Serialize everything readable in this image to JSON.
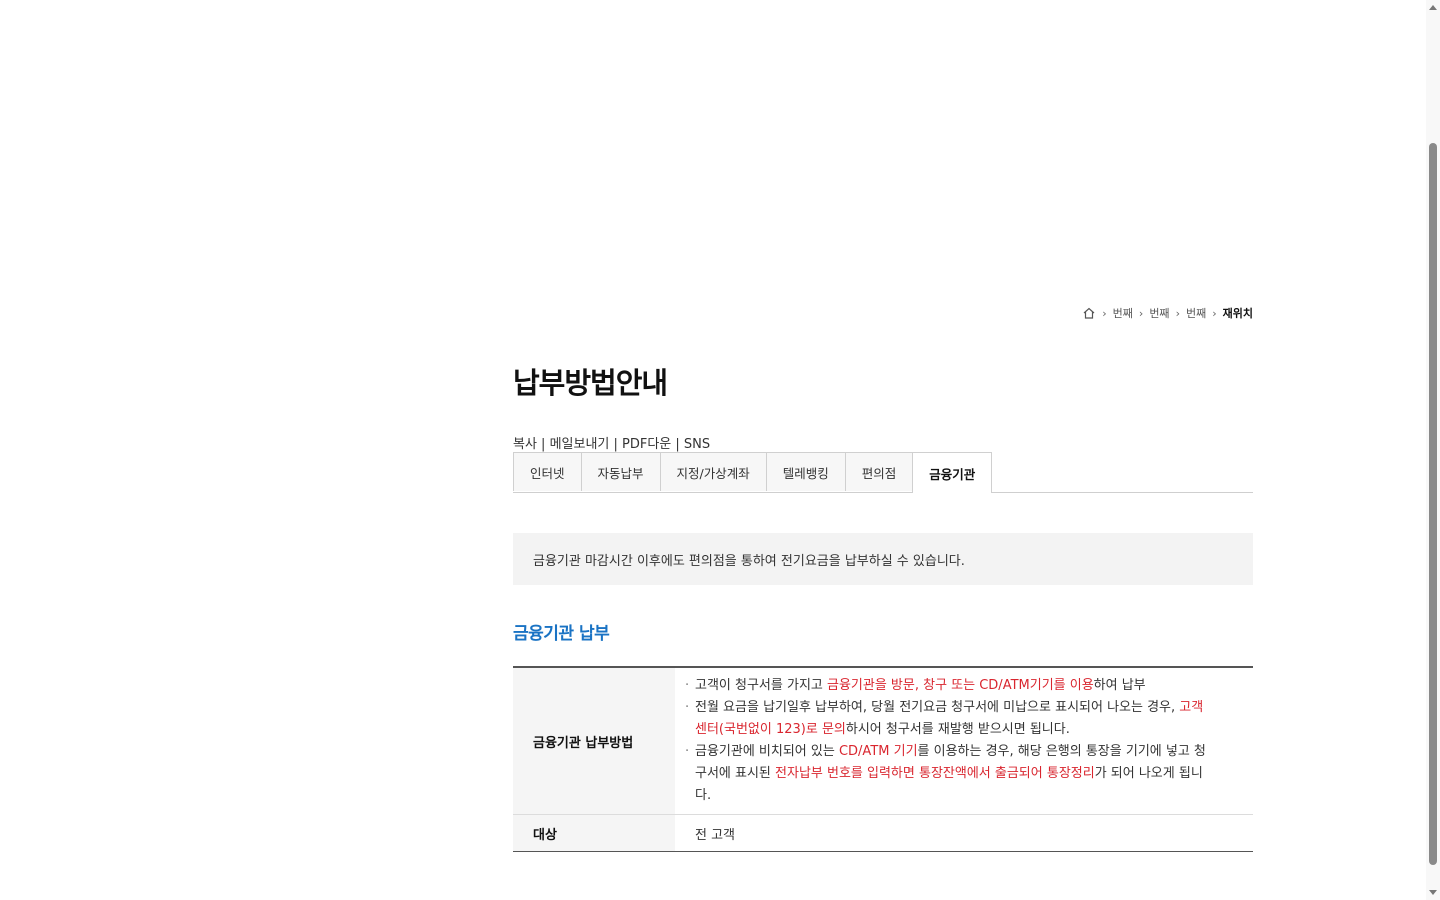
{
  "breadcrumb": {
    "items": [
      "번째",
      "번째",
      "번째"
    ],
    "current": "재위치"
  },
  "page": {
    "title": "납부방법안내",
    "tools": "복사 | 메일보내기 | PDF다운 | SNS"
  },
  "tabs": [
    {
      "label": "인터넷"
    },
    {
      "label": "자동납부"
    },
    {
      "label": "지정/가상계좌"
    },
    {
      "label": "텔레뱅킹"
    },
    {
      "label": "편의점"
    },
    {
      "label": "금융기관"
    }
  ],
  "notice": "금융기관 마감시간 이후에도 편의점을 통하여 전기요금을 납부하실 수 있습니다.",
  "section": {
    "title": "금융기관 납부"
  },
  "table": {
    "row1": {
      "header": "금융기관 납부방법",
      "b1": {
        "t1": "고객이 청구서를 가지고 ",
        "r1": "금융기관을 방문, 창구 또는 CD/ATM기기를 이용",
        "t2": "하여 납부"
      },
      "b2": {
        "t1": "전월 요금을 납기일후 납부하여, 당월 전기요금 청구서에 미납으로 표시되어 나오는 경우, ",
        "r1": "고객센터(국번없이 123)로 문의",
        "t2": "하시어 청구서를 재발행 받으시면 됩니다."
      },
      "b3": {
        "t1": "금융기관에 비치되어 있는 ",
        "r1": "CD/ATM 기기",
        "t2": "를 이용하는 경우, 해당 은행의 통장을 기기에 넣고 청구서에 표시된 ",
        "r2": "전자납부 번호를 입력하면 통장잔액에서 출금되어 통장정리",
        "t3": "가 되어 나오게 됩니다."
      }
    },
    "row2": {
      "header": "대상",
      "value": "전 고객"
    }
  },
  "colors": {
    "accent_blue": "#1a73c4",
    "highlight_red": "#d9262f"
  }
}
